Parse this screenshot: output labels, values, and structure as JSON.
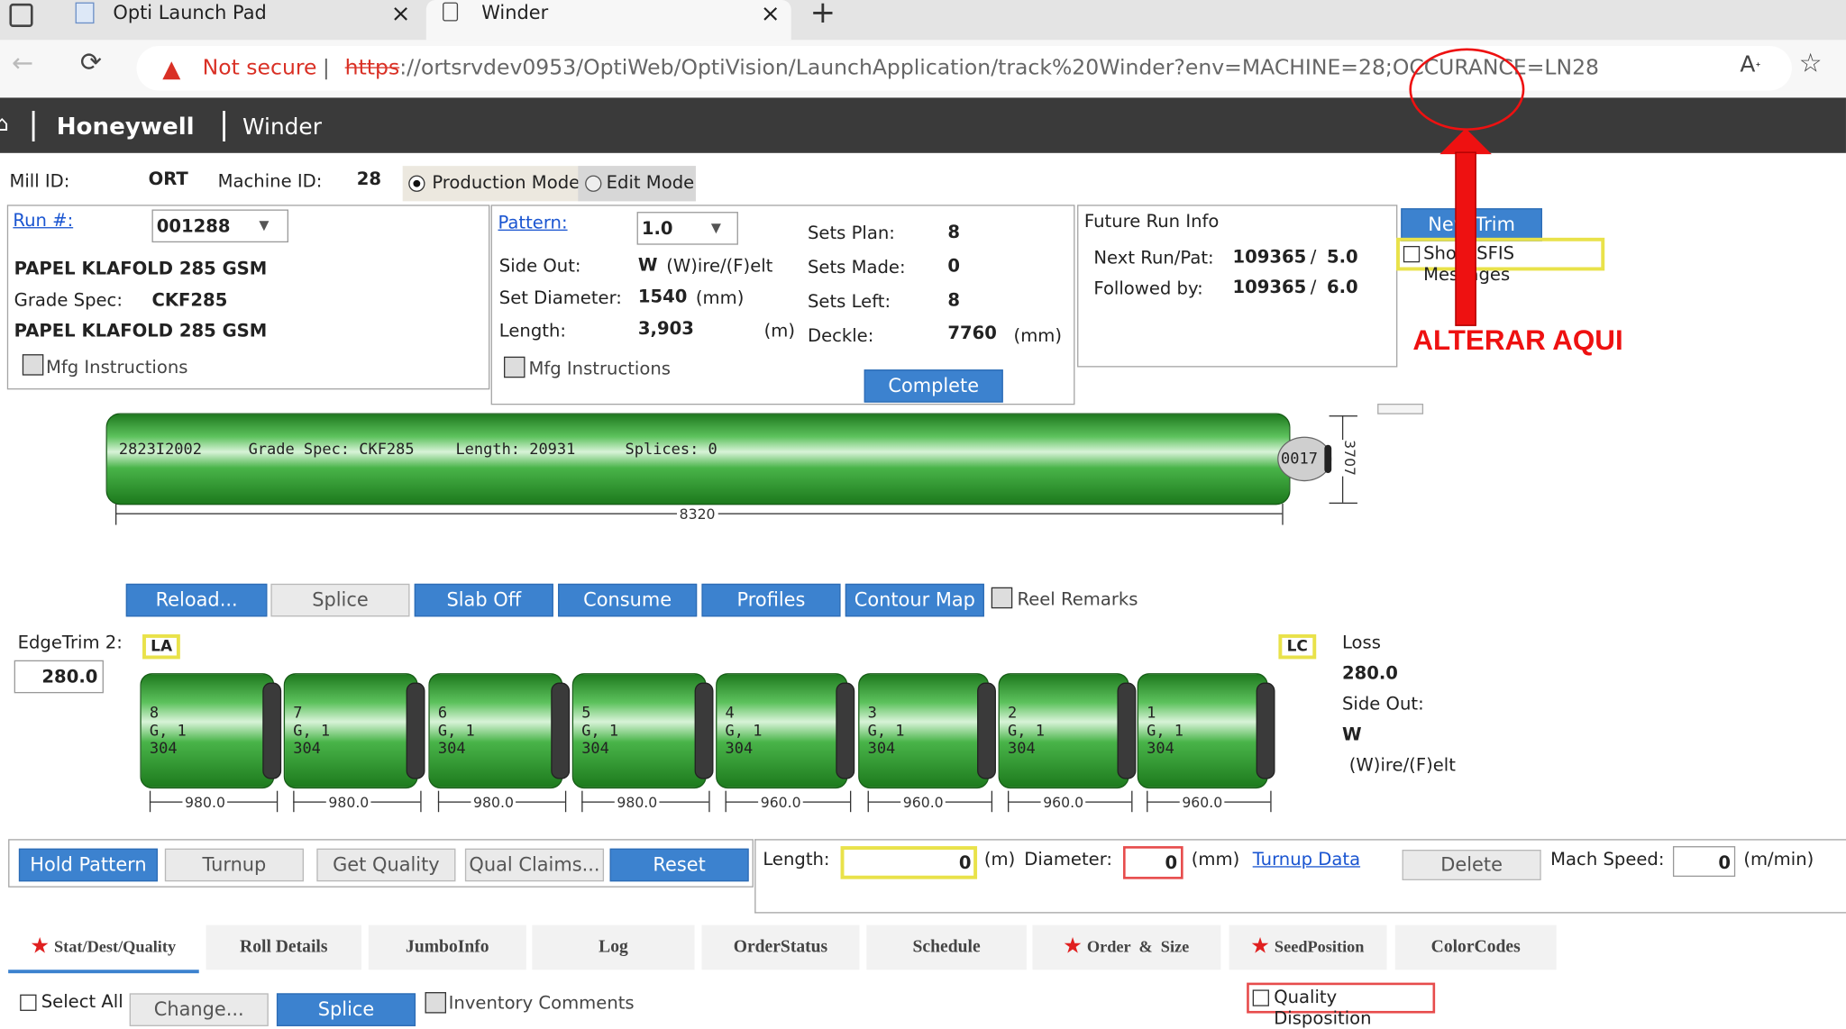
{
  "browser": {
    "tabs": [
      {
        "title": "Opti Launch Pad",
        "active": false
      },
      {
        "title": "Winder",
        "active": true
      }
    ],
    "security_label": "Not secure",
    "url_scheme": "https",
    "url_rest": "://ortsrvdev0953/OptiWeb/OptiVision/LaunchApplication/track%20Winder?env=MACHINE=28;OCCURANCE=LN28",
    "colors": {
      "warning_red": "#d93025",
      "tabstrip": "#e4e4e4"
    }
  },
  "app": {
    "brand": "Honeywell",
    "page": "Winder"
  },
  "header": {
    "mill_label": "Mill ID:",
    "mill_value": "ORT",
    "machine_label": "Machine ID:",
    "machine_value": "28",
    "mode_production": "Production Mode",
    "mode_edit": "Edit Mode",
    "selected_mode": "Production Mode"
  },
  "run": {
    "run_label": "Run #:",
    "run_value": "001288",
    "grade_name": "PAPEL KLAFOLD 285 GSM",
    "grade_spec_label": "Grade Spec:",
    "grade_spec_value": "CKF285",
    "grade_name2": "PAPEL KLAFOLD 285 GSM",
    "mfg": "Mfg Instructions"
  },
  "pattern": {
    "pattern_label": "Pattern:",
    "pattern_value": "1.0",
    "side_out_label": "Side Out:",
    "side_out_value": "W",
    "side_out_unit": "(W)ire/(F)elt",
    "set_diameter_label": "Set Diameter:",
    "set_diameter_value": "1540",
    "set_diameter_unit": "(mm)",
    "length_label": "Length:",
    "length_value": "3,903",
    "length_unit": "(m)",
    "sets_plan_label": "Sets Plan:",
    "sets_plan_value": "8",
    "sets_made_label": "Sets Made:",
    "sets_made_value": "0",
    "sets_left_label": "Sets Left:",
    "sets_left_value": "8",
    "deckle_label": "Deckle:",
    "deckle_value": "7760",
    "deckle_unit": "(mm)",
    "mfg": "Mfg Instructions",
    "complete_button": "Complete"
  },
  "future": {
    "title": "Future Run Info",
    "next_label": "Next Run/Pat:",
    "next_value": "109365",
    "next_pat": "5.0",
    "followed_label": "Followed by:",
    "followed_value": "109365",
    "followed_pat": "6.0",
    "slash": "/"
  },
  "side_actions": {
    "new_trim": "New Trim",
    "show_sfis": "Show SFIS Messages"
  },
  "annotation": {
    "label": "ALTERAR AQUI",
    "color": "#ee1111"
  },
  "jumbo": {
    "reel_id": "2823I2002",
    "grade_spec": "Grade Spec: CKF285",
    "length": "Length: 20931",
    "splices": "Splices:  0",
    "end_label": "0017",
    "width_dim": "8320",
    "height_dim": "3707"
  },
  "reel_buttons": [
    {
      "label": "Reload...",
      "enabled": true
    },
    {
      "label": "Splice",
      "enabled": false
    },
    {
      "label": "Slab Off",
      "enabled": true
    },
    {
      "label": "Consume",
      "enabled": true
    },
    {
      "label": "Profiles",
      "enabled": true
    },
    {
      "label": "Contour Map",
      "enabled": true
    }
  ],
  "reel_remarks": "Reel Remarks",
  "edgetrim": {
    "label": "EdgeTrim 2:",
    "value": "280.0",
    "la": "LA",
    "lc": "LC"
  },
  "loss": {
    "loss_label": "Loss",
    "loss_value": "280.0",
    "side_out_label": "Side Out:",
    "side_out_value": "W",
    "side_out_unit": "(W)ire/(F)elt"
  },
  "rolls": [
    {
      "num": "8",
      "grade": "G, 1",
      "code": "304",
      "width": "980.0"
    },
    {
      "num": "7",
      "grade": "G, 1",
      "code": "304",
      "width": "980.0"
    },
    {
      "num": "6",
      "grade": "G, 1",
      "code": "304",
      "width": "980.0"
    },
    {
      "num": "5",
      "grade": "G, 1",
      "code": "304",
      "width": "980.0"
    },
    {
      "num": "4",
      "grade": "G, 1",
      "code": "304",
      "width": "960.0"
    },
    {
      "num": "3",
      "grade": "G, 1",
      "code": "304",
      "width": "960.0"
    },
    {
      "num": "2",
      "grade": "G, 1",
      "code": "304",
      "width": "960.0"
    },
    {
      "num": "1",
      "grade": "G, 1",
      "code": "304",
      "width": "960.0"
    }
  ],
  "pattern_buttons": [
    {
      "label": "Hold Pattern",
      "enabled": true
    },
    {
      "label": "Turnup",
      "enabled": false
    },
    {
      "label": "Get Quality",
      "enabled": false
    },
    {
      "label": "Qual Claims...",
      "enabled": false
    },
    {
      "label": "Reset",
      "enabled": true
    }
  ],
  "turnup": {
    "length_label": "Length:",
    "length_value": "0",
    "length_unit": "(m)",
    "diameter_label": "Diameter:",
    "diameter_value": "0",
    "diameter_unit": "(mm)",
    "turnup_data": "Turnup Data",
    "delete": "Delete",
    "speed_label": "Mach Speed:",
    "speed_value": "0",
    "speed_unit": "(m/min)"
  },
  "tabs": [
    {
      "label": "Stat/Dest/Quality",
      "star": true,
      "active": true
    },
    {
      "label": "Roll Details",
      "star": false
    },
    {
      "label": "JumboInfo",
      "star": false
    },
    {
      "label": "Log",
      "star": false
    },
    {
      "label": "OrderStatus",
      "star": false
    },
    {
      "label": "Schedule",
      "star": false
    },
    {
      "label": "Order  &  Size",
      "star": true
    },
    {
      "label": "SeedPosition",
      "star": true
    },
    {
      "label": "ColorCodes",
      "star": false
    }
  ],
  "bottom": {
    "select_all": "Select All",
    "change": "Change...",
    "splice": "Splice",
    "inventory": "Inventory Comments",
    "quality_disposition": "Quality Disposition"
  }
}
